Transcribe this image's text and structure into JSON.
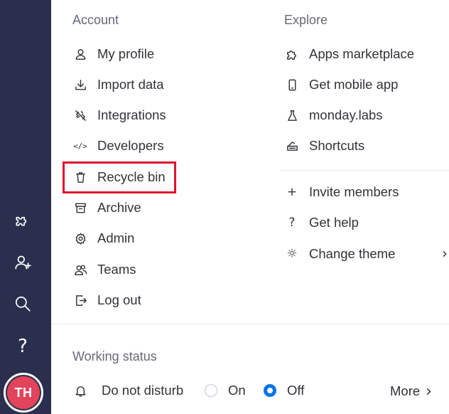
{
  "sidebar": {
    "icons": [
      "puzzle-icon",
      "add-user-icon",
      "search-icon",
      "help-icon"
    ],
    "help_glyph": "?",
    "avatar_initials": "TH"
  },
  "account": {
    "title": "Account",
    "items": [
      {
        "label": "My profile",
        "icon": "user-icon"
      },
      {
        "label": "Import data",
        "icon": "download-icon"
      },
      {
        "label": "Integrations",
        "icon": "plug-icon"
      },
      {
        "label": "Developers",
        "icon": "code-icon",
        "glyph": "</>"
      },
      {
        "label": "Recycle bin",
        "icon": "trash-icon"
      },
      {
        "label": "Archive",
        "icon": "archive-icon"
      },
      {
        "label": "Admin",
        "icon": "gear-icon"
      },
      {
        "label": "Teams",
        "icon": "teams-icon"
      },
      {
        "label": "Log out",
        "icon": "logout-icon"
      }
    ]
  },
  "explore": {
    "title": "Explore",
    "items": [
      {
        "label": "Apps marketplace",
        "icon": "puzzle-icon"
      },
      {
        "label": "Get mobile app",
        "icon": "mobile-icon"
      },
      {
        "label": "monday.labs",
        "icon": "flask-icon"
      },
      {
        "label": "Shortcuts",
        "icon": "keyboard-icon"
      }
    ],
    "more_items": [
      {
        "label": "Invite members",
        "icon": "plus-icon",
        "glyph": "+"
      },
      {
        "label": "Get help",
        "icon": "question-icon",
        "glyph": "?"
      },
      {
        "label": "Change theme",
        "icon": "sun-icon",
        "glyph": "☼"
      }
    ]
  },
  "working_status": {
    "title": "Working status",
    "dnd_label": "Do not disturb",
    "on_label": "On",
    "off_label": "Off",
    "selected": "Off",
    "more_label": "More",
    "chevron": "›"
  },
  "colors": {
    "sidebar_bg": "#292f4c",
    "avatar": "#e2445c",
    "highlight": "#e0142c",
    "radio_selected": "#0073ea"
  }
}
